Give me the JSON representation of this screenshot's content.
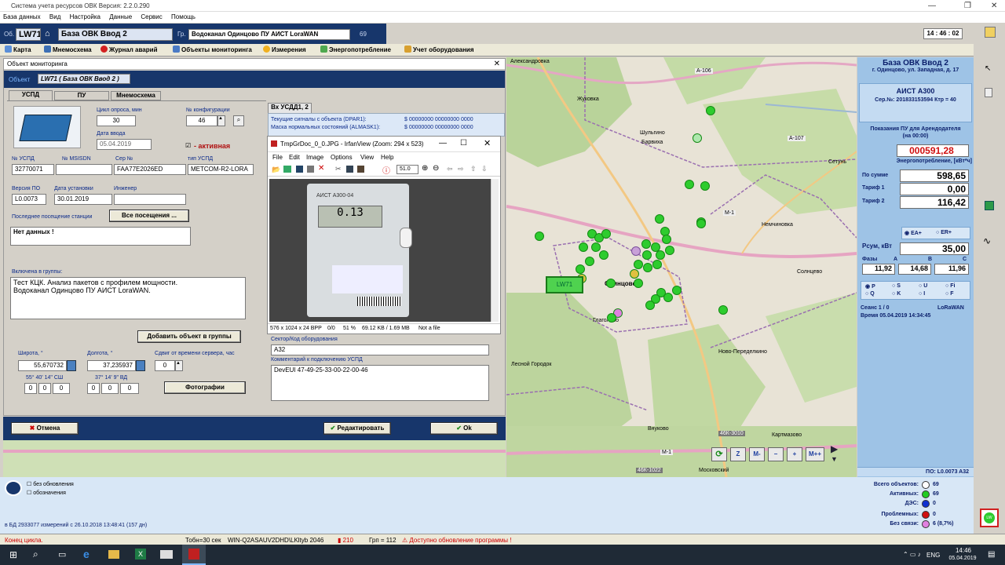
{
  "window": {
    "title": "Система учета ресурсов ОВК   Версия: 2.2.0.290"
  },
  "menu": [
    "База данных",
    "Вид",
    "Настройка",
    "Данные",
    "Сервис",
    "Помощь"
  ],
  "header": {
    "obj_prefix": "Об.",
    "obj_code": "LW71",
    "obj_name": "База ОВК Ввод 2",
    "group_prefix": "Гр.",
    "group_name": "Водоканал Одинцово ПУ АИСТ LoraWAN",
    "group_count": "69",
    "clock": "14 : 46 : 02"
  },
  "tabs": [
    "Карта",
    "Мнемосхема",
    "Журнал аварий",
    "Объекты мониторинга",
    "Измерения",
    "Энергопотребление",
    "Учет оборудования"
  ],
  "dialog": {
    "title": "Объект мониторинга",
    "obj_label": "Объект",
    "obj_value": "LW71   ( База ОВК Ввод 2 )",
    "tabs": [
      "УСПД",
      "ПУ",
      "Мнемосхема"
    ],
    "poll_label": "Цикл опроса, мин",
    "poll_value": "30",
    "config_label": "№ конфигурации",
    "config_value": "46",
    "date_label": "Дата ввода",
    "date_value": "05.04.2019",
    "active_label": "- активная",
    "uspd_label": "№ УСПД",
    "uspd_value": "32770071",
    "msisdn_label": "№ MSISDN",
    "msisdn_value": "",
    "ser_label": "Сер №",
    "ser_value": "FAA77E2026ED",
    "type_label": "тип УСПД",
    "type_value": "METCOM-R2-LORA",
    "ver_label": "Версия ПО",
    "ver_value": "L0.0073",
    "inst_label": "Дата установки",
    "inst_value": "30.01.2019",
    "eng_label": "Инженер",
    "eng_value": "",
    "visit_label": "Последнее посещение станции",
    "visit_btn": "Все посещения ...",
    "visit_value": "Нет данных !",
    "groups_label": "Включена в группы:",
    "groups_text": "Тест КЦК. Анализ пакетов с профилем мощности.\nВодоканал Одинцово ПУ АИСТ LoraWAN.",
    "add_group_btn": "Добавить объект в группы",
    "lat_label": "Широта, °",
    "lat_value": "55,670732",
    "lat_dms": "55° 40' 14\" СШ",
    "lat_parts": [
      "0",
      "0",
      "0"
    ],
    "lon_label": "Долгота, °",
    "lon_value": "37,235937",
    "lon_dms": "37° 14' 9\" ВД",
    "lon_parts": [
      "0",
      "0",
      "0"
    ],
    "shift_label": "Сдвиг от времени сервера, час",
    "shift_value": "0",
    "photos_btn": "Фотографии",
    "inputs_tab": "Вх УСДД1, 2",
    "signals1_label": "Текущие сигналы с объекта (DPAR1):",
    "signals1_value": "$ 00000000 00000000 0000",
    "signals2_label": "Маска нормальных состояний (ALMASK1):",
    "signals2_value": "$ 00000000 00000000 0000",
    "sector_label": "Сектор/Код оборудования",
    "sector_value": "A32",
    "comment_label": "Комментарий к подключению УСПД",
    "comment_value": "DevEUI 47-49-25-33-00-22-00-46",
    "cancel_btn": "Отмена",
    "edit_btn": "Редактировать",
    "ok_btn": "Ok"
  },
  "irfan": {
    "title": "TmpGrDoc_0_0.JPG - IrfanView (Zoom: 294 x 523)",
    "menu": [
      "File",
      "Edit",
      "Image",
      "Options",
      "View",
      "Help"
    ],
    "zoom": "51.0",
    "meter_model": "АИСТ А300-04",
    "meter_reading": "0.13",
    "status": [
      "576 x 1024 x 24 BPP",
      "0/0",
      "51 %",
      "69.12 KB / 1.69 MB",
      "Not a file"
    ]
  },
  "map": {
    "label": "LW71",
    "places": [
      "Александровка",
      "Жуковка",
      "Барвиха",
      "Шульгино",
      "Сетунь",
      "Одинцово",
      "Немчиновка",
      "Лесной Городок",
      "Ново-Переделкино",
      "Внуково",
      "Московский",
      "Картмазово",
      "Глаголево",
      "Солнцево"
    ],
    "roads": [
      "А-106",
      "М-1",
      "М-1",
      "А-107",
      "46К-1022",
      "46К-3010"
    ]
  },
  "right": {
    "obj_title": "База ОВК Ввод 2",
    "obj_addr": "г. Одинцово, ул. Западная, д. 17",
    "dev": "АИСТ А300",
    "ser": "Сер.№: 201833153594  Ктр = 40",
    "readings_title": "Показания ПУ для Арендодателя (на 00:00)",
    "total_red": "000591,28",
    "energy_label": "Энергопотребление, [кВт*ч]",
    "sum_label": "По сумме",
    "sum": "598,65",
    "t1_label": "Тариф 1",
    "t1": "0,00",
    "t2_label": "Тариф 2",
    "t2": "116,42",
    "ea": "EA+",
    "er": "ER+",
    "p_label": "Рсум, кВт",
    "p": "35,00",
    "phases_label": "Фазы",
    "phase_names": [
      "A",
      "B",
      "C"
    ],
    "phases": [
      "11,92",
      "14,68",
      "11,96"
    ],
    "radio": [
      "P",
      "S",
      "U",
      "Fi",
      "Q",
      "K",
      "I",
      "F"
    ],
    "session_label": "Сеанс",
    "session": "1 / 0",
    "net": "LoRaWAN",
    "time_label": "Время",
    "time": "05.04.2019  14:34:45",
    "po": "ПО: L0.0073 A32"
  },
  "bottom": {
    "no_update": "без обновления",
    "legend": "обозначения",
    "db": "в БД 2933077 измерений с 26.10.2018 13:48:41 (157 дн)",
    "stats": [
      {
        "label": "Всего объектов:",
        "value": "69",
        "color": "#ffffff"
      },
      {
        "label": "Активных:",
        "value": "69",
        "color": "#22cc22"
      },
      {
        "label": "ДЭС:",
        "value": "0",
        "color": "#1030d0"
      },
      {
        "label": "Проблемных:",
        "value": "0",
        "color": "#d01010"
      },
      {
        "label": "Без связи:",
        "value": "6 (8,7%)",
        "color": "#e080e0"
      }
    ]
  },
  "status": {
    "cycle": "Конец цикла.",
    "tobn": "Тобн=30 сек",
    "host": "WIN-Q2ASAUV2DHD\\LKltyb  2046",
    "n": "210",
    "gr": "Грп = 112",
    "update": "Доступно обновление программы !"
  },
  "taskbar": {
    "lang": "ENG",
    "time": "14:46",
    "date": "05.04.2019"
  },
  "map_buttons": [
    "Z",
    "M-",
    "−",
    "+",
    "M++"
  ]
}
